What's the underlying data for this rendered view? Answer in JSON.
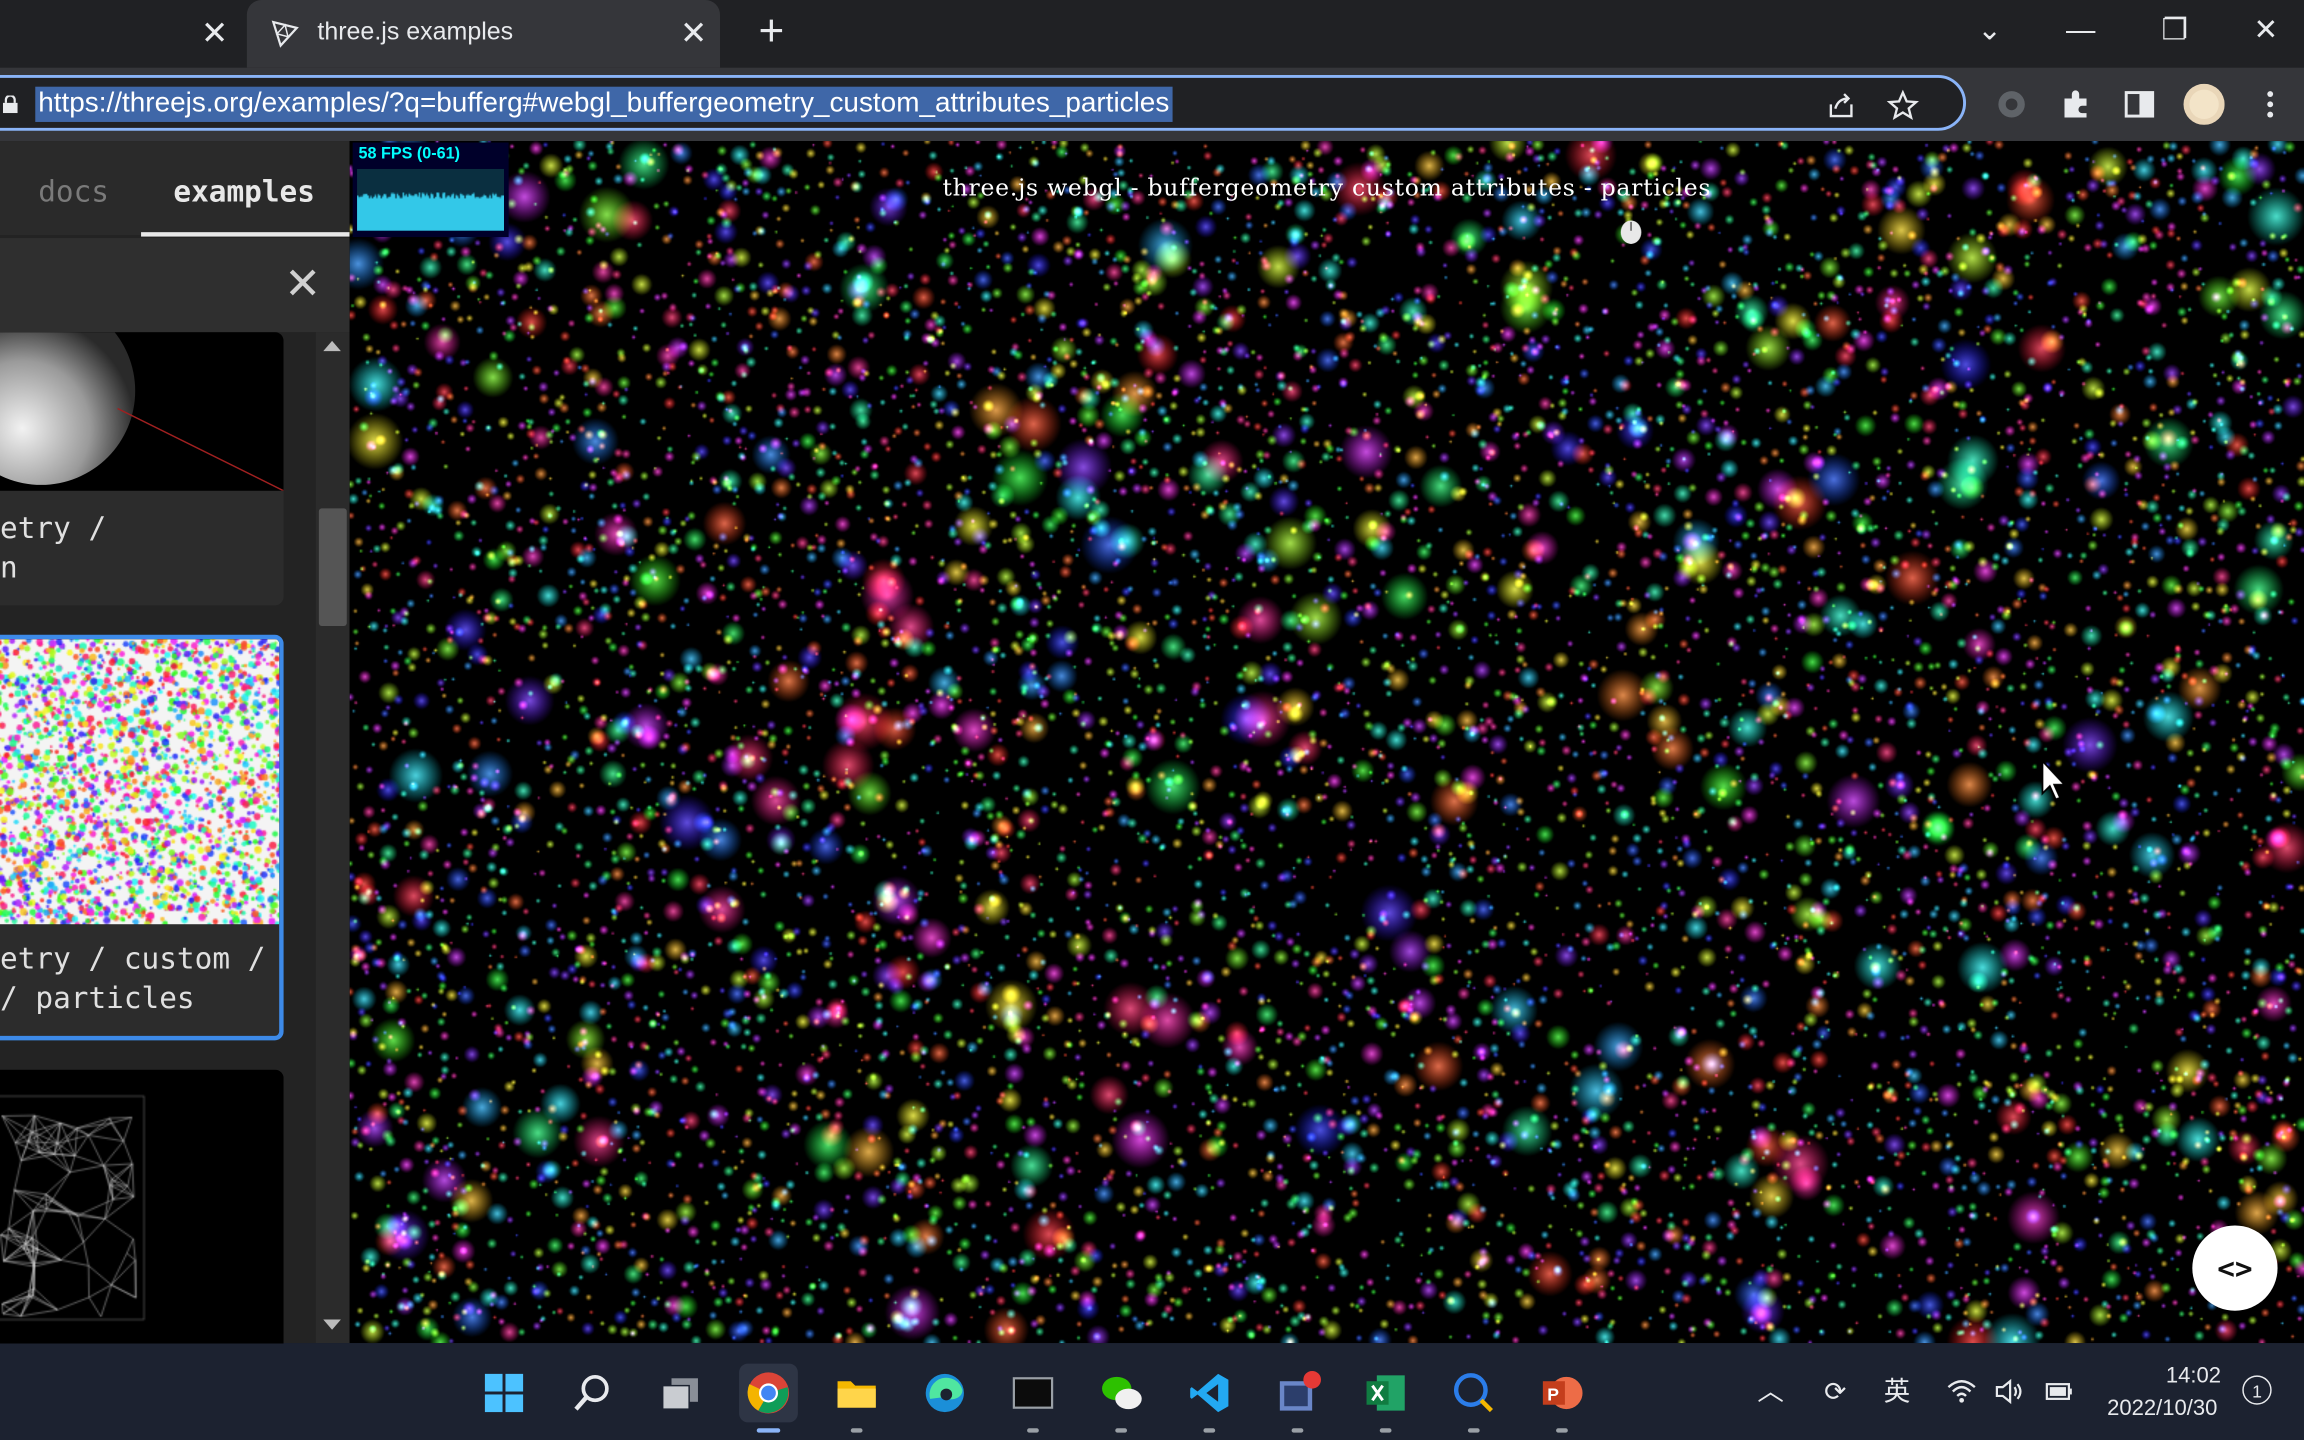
{
  "tabs": [
    {
      "title": "",
      "active": false
    },
    {
      "title": "three.js examples",
      "active": true
    }
  ],
  "address_bar": {
    "url": "https://threejs.org/examples/?q=bufferg#webgl_buffergeometry_custom_attributes_particles"
  },
  "sidebar": {
    "nav": {
      "docs": "docs",
      "examples": "examples"
    },
    "search": {
      "value": ""
    },
    "cards": [
      {
        "label": "etry /\nn",
        "selected": false
      },
      {
        "label": "etry / custom /\n/ particles",
        "selected": true
      },
      {
        "label": "",
        "selected": false
      }
    ]
  },
  "viewport": {
    "title": "three.js webgl - buffergeometry custom attributes - particles",
    "stats": "58 FPS (0-61)",
    "code_button": "<>"
  },
  "taskbar": {
    "apps": [
      "start-icon",
      "search-icon",
      "task-view-icon",
      "chrome-icon",
      "file-explorer-icon",
      "edge-icon",
      "terminal-icon",
      "wechat-icon",
      "vscode-icon",
      "video-app-icon",
      "excel-icon",
      "search-app-icon",
      "powerpoint-icon"
    ],
    "ime": "英",
    "time": "14:02",
    "date": "2022/10/30",
    "notifications": "1"
  },
  "colors": {
    "accent": "#8ab4f8",
    "selected_card_border": "#3d8ae8",
    "tab_strip": "#202124",
    "toolbar": "#35363a"
  }
}
